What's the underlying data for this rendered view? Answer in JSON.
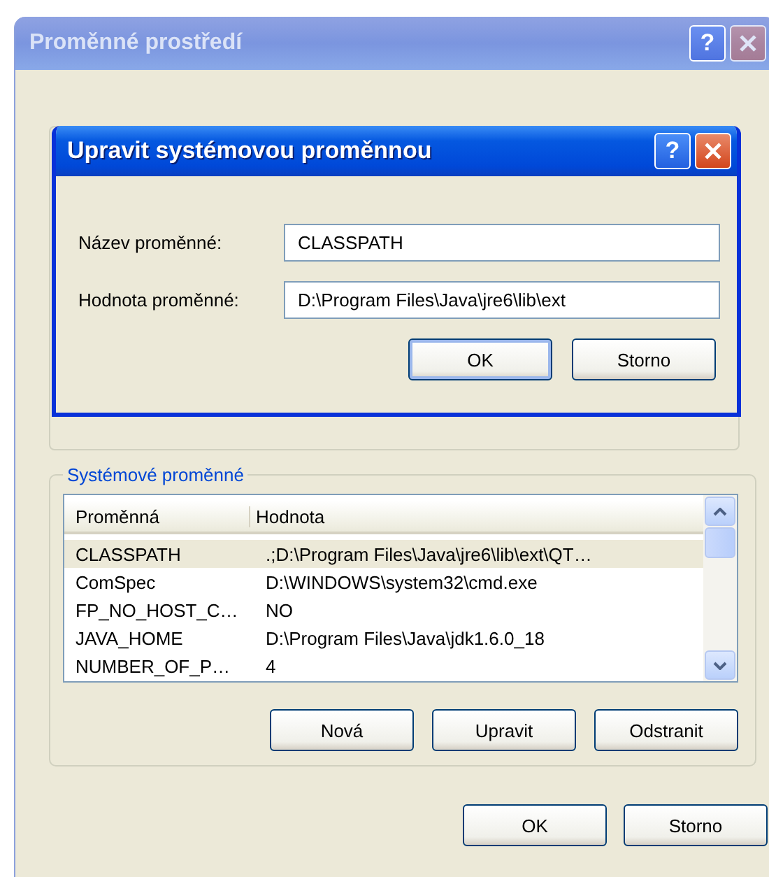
{
  "main_window": {
    "title": "Proměnné prostředí",
    "help_glyph": "?",
    "system_variables": {
      "legend": "Systémové proměnné",
      "columns": [
        "Proměnná",
        "Hodnota"
      ],
      "rows": [
        {
          "name": "CLASSPATH",
          "value": ".;D:\\Program Files\\Java\\jre6\\lib\\ext\\QT…",
          "selected": true
        },
        {
          "name": "ComSpec",
          "value": "D:\\WINDOWS\\system32\\cmd.exe",
          "selected": false
        },
        {
          "name": "FP_NO_HOST_C…",
          "value": "NO",
          "selected": false
        },
        {
          "name": "JAVA_HOME",
          "value": "D:\\Program Files\\Java\\jdk1.6.0_18",
          "selected": false
        },
        {
          "name": "NUMBER_OF_P…",
          "value": "4",
          "selected": false
        }
      ],
      "buttons": [
        "Nová",
        "Upravit",
        "Odstranit"
      ]
    },
    "buttons": [
      "OK",
      "Storno"
    ]
  },
  "edit_dialog": {
    "title": "Upravit systémovou proměnnou",
    "help_glyph": "?",
    "fields": [
      {
        "label": "Název proměnné:",
        "value": "CLASSPATH"
      },
      {
        "label": "Hodnota proměnné:",
        "value": "D:\\Program Files\\Java\\jre6\\lib\\ext"
      }
    ],
    "buttons": [
      {
        "label": "OK",
        "default": true
      },
      {
        "label": "Storno",
        "default": false
      }
    ]
  }
}
